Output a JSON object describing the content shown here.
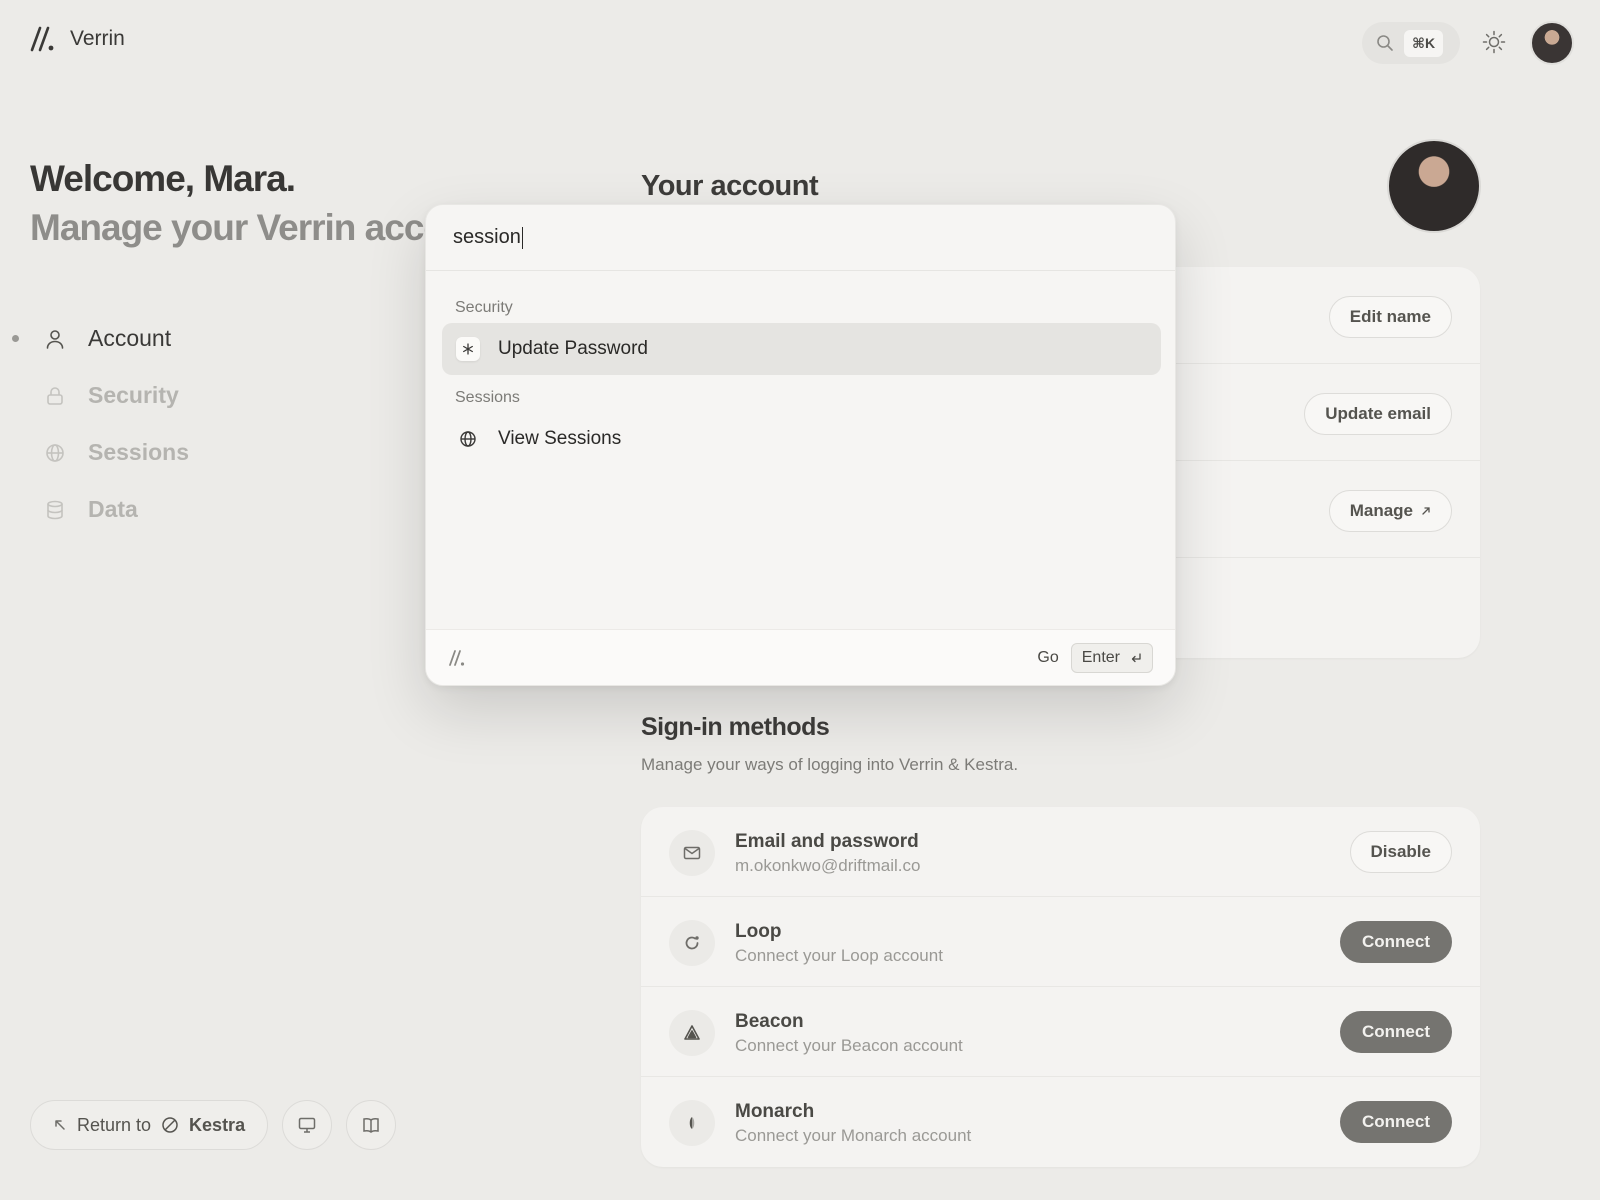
{
  "brand": {
    "name": "Verrin",
    "logo_icon": "slash-logo-icon"
  },
  "topbar": {
    "search_shortcut": "⌘K",
    "search_icon": "search-icon",
    "theme_icon": "sun-icon"
  },
  "welcome": {
    "title": "Welcome, Mara.",
    "subtitle": "Manage your Verrin account"
  },
  "sidebar": {
    "items": [
      {
        "label": "Account",
        "icon": "user-icon",
        "active": true
      },
      {
        "label": "Security",
        "icon": "lock-icon",
        "active": false
      },
      {
        "label": "Sessions",
        "icon": "globe-icon",
        "active": false
      },
      {
        "label": "Data",
        "icon": "database-icon",
        "active": false
      }
    ]
  },
  "footer": {
    "return_label": "Return to",
    "return_target": "Kestra"
  },
  "account": {
    "title": "Your account",
    "buttons": {
      "edit_name": "Edit name",
      "update_email": "Update email",
      "manage": "Manage"
    }
  },
  "signin": {
    "title": "Sign-in methods",
    "subtitle": "Manage your ways of logging into Verrin & Kestra.",
    "methods": [
      {
        "title": "Email and password",
        "sub": "m.okonkwo@driftmail.co",
        "action": "Disable",
        "icon": "mail-icon"
      },
      {
        "title": "Loop",
        "sub": "Connect your Loop account",
        "action": "Connect",
        "icon": "loop-icon"
      },
      {
        "title": "Beacon",
        "sub": "Connect your Beacon account",
        "action": "Connect",
        "icon": "beacon-icon"
      },
      {
        "title": "Monarch",
        "sub": "Connect your Monarch account",
        "action": "Connect",
        "icon": "monarch-icon"
      }
    ]
  },
  "palette": {
    "query": "session",
    "groups": [
      {
        "label": "Security",
        "results": [
          {
            "label": "Update Password",
            "icon": "asterisk-icon",
            "selected": true
          }
        ]
      },
      {
        "label": "Sessions",
        "results": [
          {
            "label": "View Sessions",
            "icon": "globe-icon",
            "selected": false
          }
        ]
      }
    ],
    "footer": {
      "go_label": "Go",
      "enter_label": "Enter"
    }
  },
  "colors": {
    "background": "#ecebe8",
    "palette_bg": "#f6f5f3",
    "selected_bg": "#e5e4e1",
    "connect_button": "#757470"
  }
}
